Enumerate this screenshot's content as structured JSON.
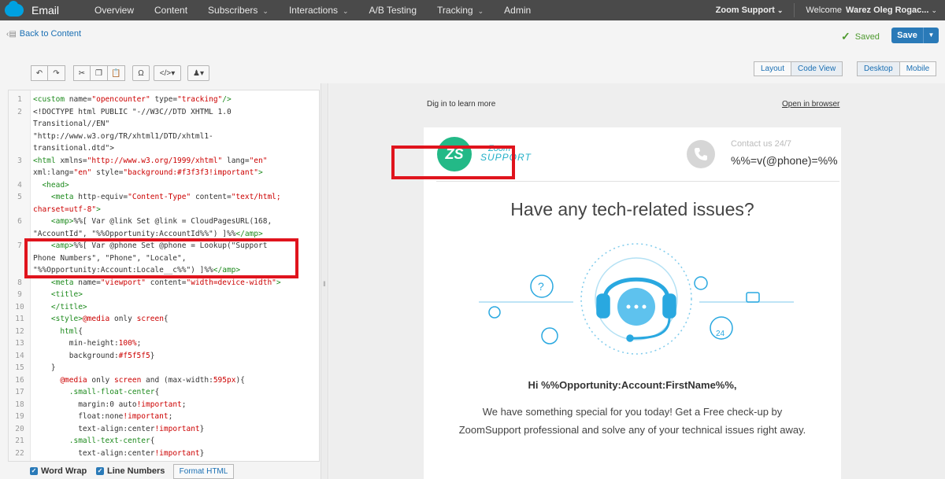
{
  "topnav": {
    "brand": "Email",
    "items": [
      {
        "label": "Overview",
        "has_dropdown": false
      },
      {
        "label": "Content",
        "has_dropdown": false
      },
      {
        "label": "Subscribers",
        "has_dropdown": true
      },
      {
        "label": "Interactions",
        "has_dropdown": true
      },
      {
        "label": "A/B Testing",
        "has_dropdown": false
      },
      {
        "label": "Tracking",
        "has_dropdown": true
      },
      {
        "label": "Admin",
        "has_dropdown": false
      }
    ],
    "account": "Zoom Support",
    "welcome": "Welcome",
    "user": "Warez Oleg Rogac..."
  },
  "subheader": {
    "back_label": "Back to Content",
    "saved_label": "Saved",
    "save_label": "Save"
  },
  "toolbar": {
    "omega_label": "Ω",
    "code_label": "</>"
  },
  "view_toggle": {
    "layout": "Layout",
    "code_view": "Code View",
    "desktop": "Desktop",
    "mobile": "Mobile"
  },
  "editor": {
    "word_wrap": "Word Wrap",
    "line_numbers": "Line Numbers",
    "format_button": "Format HTML"
  },
  "preview": {
    "dig_in": "Dig in to learn more",
    "open_in_browser": "Open in browser",
    "logo_initials": "ZS",
    "logo_line1": "Zoom",
    "logo_line2": "SUPPORT",
    "contact_label": "Contact us 24/7",
    "phone_value": "%%=v(@phone)=%%",
    "headline": "Have any tech-related issues?",
    "greeting": "Hi %%Opportunity:Account:FirstName%%,",
    "body": "We have something special for you today! Get a Free check-up by ZoomSupport professional and solve any of your technical issues right away.",
    "badge_24": "24"
  },
  "colors": {
    "nav_bg": "#4a4a4a",
    "accent_blue": "#2a7ab8",
    "highlight_red": "#e0141d",
    "brand_green": "#23b987",
    "illus_blue": "#29a8e0"
  }
}
